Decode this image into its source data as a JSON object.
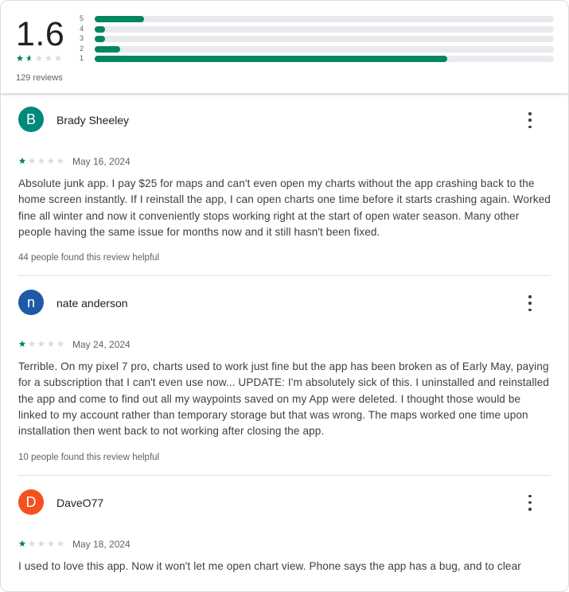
{
  "summary": {
    "average": "1.6",
    "average_value": 1.6,
    "review_count": "129 reviews",
    "distribution": [
      {
        "label": "5",
        "fraction": 0.107
      },
      {
        "label": "4",
        "fraction": 0.023
      },
      {
        "label": "3",
        "fraction": 0.023
      },
      {
        "label": "2",
        "fraction": 0.055
      },
      {
        "label": "1",
        "fraction": 0.767
      }
    ],
    "accent_color": "#01875f",
    "track_color": "#e8eaed"
  },
  "reviews": [
    {
      "initial": "B",
      "avatar_color": "#00897b",
      "author": "Brady Sheeley",
      "rating": 1,
      "date": "May 16, 2024",
      "text": "Absolute junk app. I pay $25 for maps and can't even open my charts without the app crashing back to the home screen instantly. If I reinstall the app, I can open charts one time before it starts crashing again. Worked fine all winter and now it conveniently stops working right at the start of open water season. Many other people having the same issue for months now and it still hasn't been fixed.",
      "helpful": "44 people found this review helpful"
    },
    {
      "initial": "n",
      "avatar_color": "#1e5aa8",
      "author": "nate anderson",
      "rating": 1,
      "date": "May 24, 2024",
      "text": "Terrible. On my pixel 7 pro, charts used to work just fine but the app has been broken as of Early May, paying for a subscription that I can't even use now... UPDATE: I'm absolutely sick of this. I uninstalled and reinstalled the app and come to find out all my waypoints saved on my App were deleted. I thought those would be linked to my account rather than temporary storage but that was wrong. The maps worked one time upon installation then went back to not working after closing the app.",
      "helpful": "10 people found this review helpful"
    },
    {
      "initial": "D",
      "avatar_color": "#f4511e",
      "author": "DaveO77",
      "rating": 1,
      "date": "May 18, 2024",
      "text": "I used to love this app. Now it won't let me open chart view. Phone says the app has a bug, and to clear",
      "helpful": ""
    }
  ],
  "icons": {
    "star": "star-icon",
    "more": "more-vert-icon"
  }
}
